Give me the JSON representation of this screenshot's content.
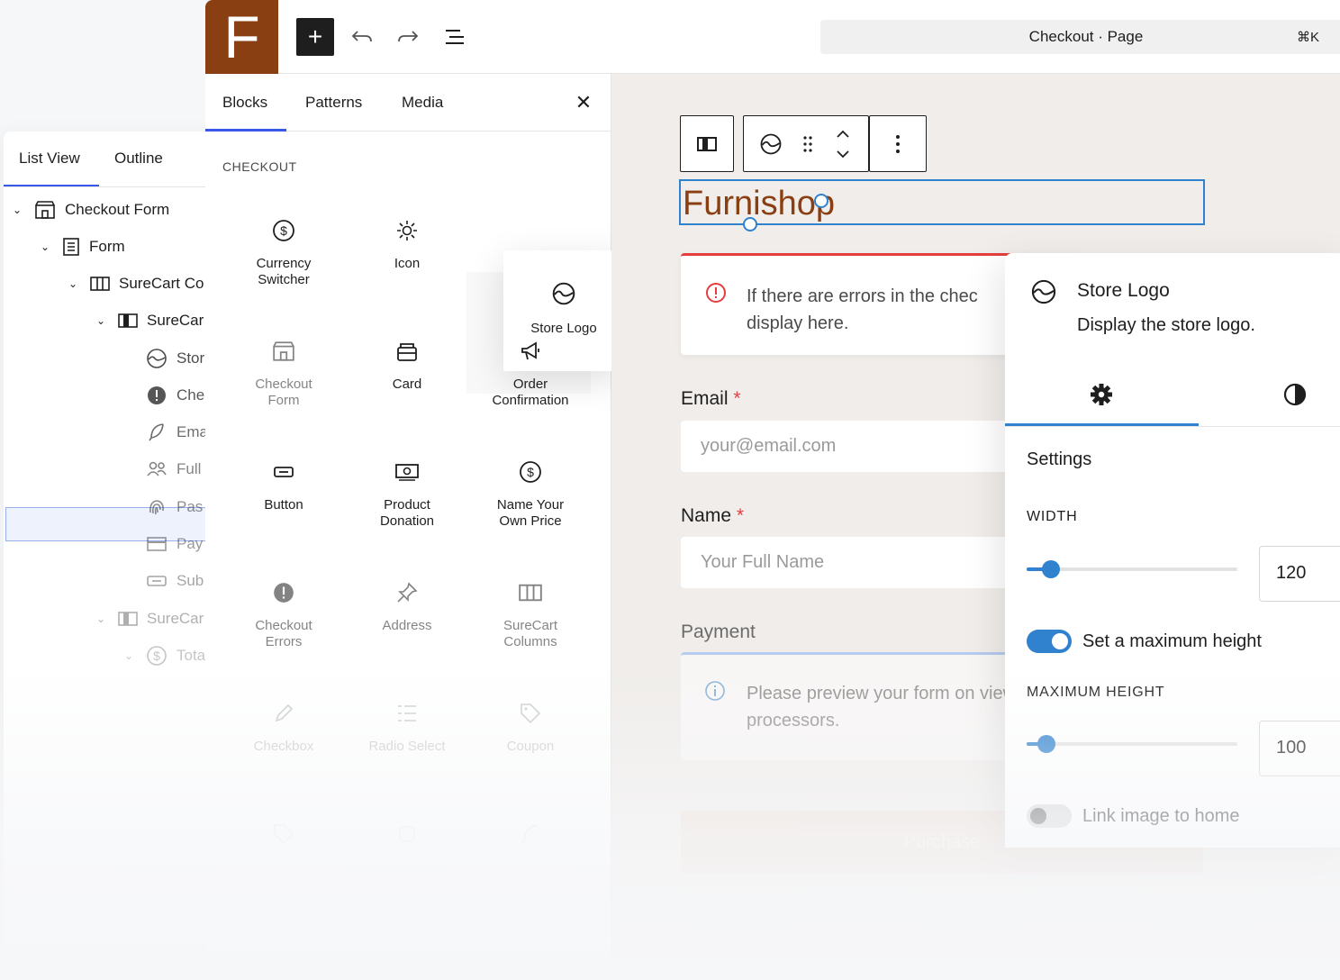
{
  "list_view": {
    "tabs": [
      "List View",
      "Outline"
    ],
    "rows": [
      {
        "label": "Checkout Form",
        "icon": "store-icon"
      },
      {
        "label": "Form",
        "icon": "form-icon"
      },
      {
        "label": "SureCart Co",
        "icon": "columns-icon"
      },
      {
        "label": "SureCar",
        "icon": "column-icon"
      },
      {
        "label": "Stor",
        "icon": "store-logo-icon"
      },
      {
        "label": "Che",
        "icon": "alert-icon"
      },
      {
        "label": "Ema",
        "icon": "feather-icon"
      },
      {
        "label": "Full",
        "icon": "users-icon"
      },
      {
        "label": "Pas",
        "icon": "fingerprint-icon"
      },
      {
        "label": "Pay",
        "icon": "credit-card-icon"
      },
      {
        "label": "Sub",
        "icon": "button-icon"
      },
      {
        "label": "SureCar",
        "icon": "column-icon"
      },
      {
        "label": "Tota",
        "icon": "dollar-icon"
      }
    ]
  },
  "topbar": {
    "site_letter": "F",
    "add_label": "+",
    "document_title": "Checkout · Page",
    "shortcut": "⌘K"
  },
  "inserter": {
    "tabs": [
      "Blocks",
      "Patterns",
      "Media"
    ],
    "section": "CHECKOUT",
    "dragging_block": "Store Logo",
    "blocks": [
      {
        "label": "Currency\nSwitcher",
        "icon": "currency-icon"
      },
      {
        "label": "Icon",
        "icon": "sun-icon"
      },
      {
        "label": "Checkout\nForm",
        "icon": "store-icon"
      },
      {
        "label": "Card",
        "icon": "card-icon"
      },
      {
        "label": "Order\nConfirmation",
        "icon": "megaphone-icon"
      },
      {
        "label": "Button",
        "icon": "button-icon"
      },
      {
        "label": "Product\nDonation",
        "icon": "money-icon"
      },
      {
        "label": "Name Your\nOwn Price",
        "icon": "currency-icon"
      },
      {
        "label": "Checkout\nErrors",
        "icon": "alert-icon"
      },
      {
        "label": "Address",
        "icon": "pin-icon"
      },
      {
        "label": "SureCart\nColumns",
        "icon": "columns-icon"
      },
      {
        "label": "Checkbox",
        "icon": "pencil-icon"
      },
      {
        "label": "Radio Select",
        "icon": "list-icon"
      },
      {
        "label": "Coupon",
        "icon": "tag-icon"
      }
    ]
  },
  "canvas": {
    "logo_text": "Furnishop",
    "error_text": "If there are errors in the chec display here.",
    "email_label": "Email",
    "email_placeholder": "your@email.com",
    "name_label": "Name",
    "name_placeholder": "Your Full Name",
    "required_mark": "*",
    "payment_label": "Payment",
    "info_text": "Please preview your form on view processors.",
    "submit_label": "Purchase"
  },
  "settings": {
    "title": "Store Logo",
    "description": "Display the store logo.",
    "section_heading": "Settings",
    "width_label": "WIDTH",
    "width_value": "120",
    "width_fraction": 0.08,
    "max_height_toggle_label": "Set a maximum height",
    "max_height_toggle_on": true,
    "max_height_label": "MAXIMUM HEIGHT",
    "max_height_value": "100",
    "max_height_fraction": 0.06,
    "link_toggle_label": "Link image to home",
    "link_toggle_on": false
  },
  "colors": {
    "brand": "#8a3f12",
    "accent": "#3182ce",
    "error": "#e53e3e",
    "wp_blue": "#3858e9"
  }
}
